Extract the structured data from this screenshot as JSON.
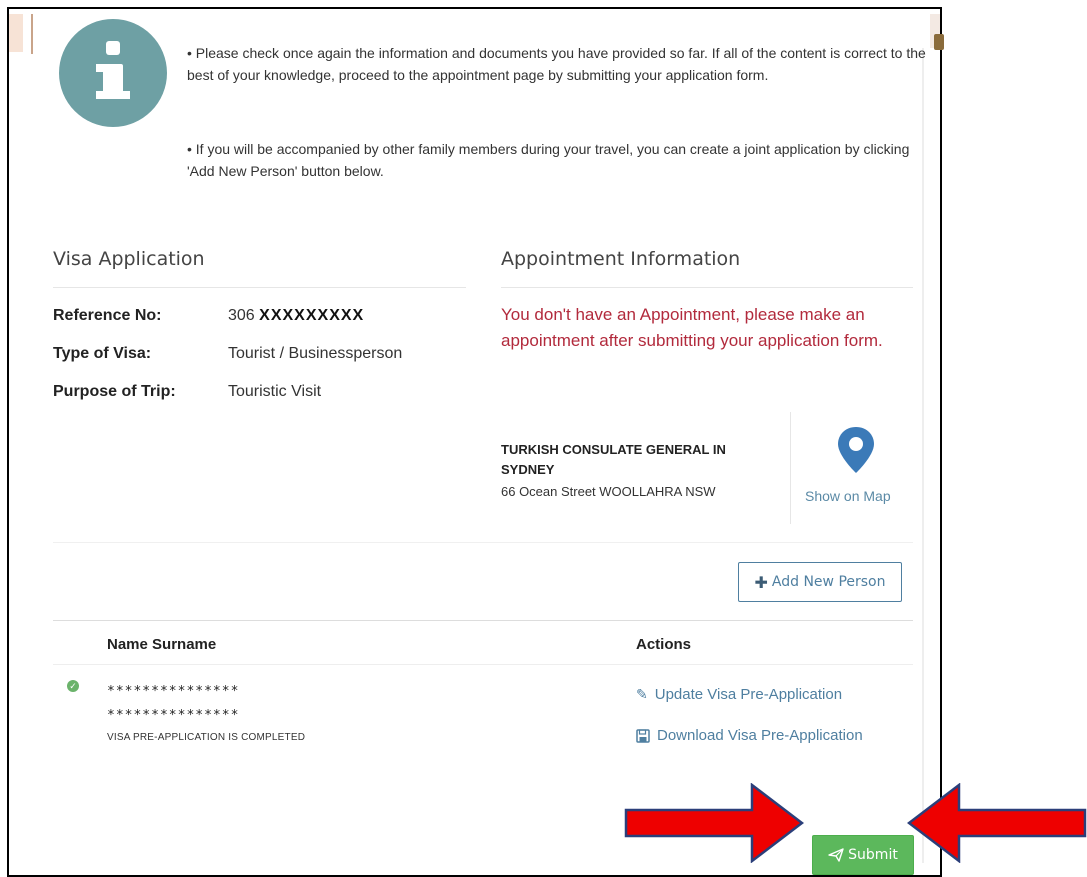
{
  "notice": {
    "line1": "• Please check once again the information and documents you have provided so far. If all of the content is correct to the best of your knowledge, proceed to the appointment page by submitting your application form.",
    "line2": "• If you will be accompanied by other family members during your travel, you can create a joint application by clicking 'Add New Person' button below."
  },
  "visa_application": {
    "title": "Visa Application",
    "fields": [
      {
        "label": "Reference No:",
        "value_prefix": "306",
        "value_masked": "XXXXXXXXX"
      },
      {
        "label": "Type of Visa:",
        "value": "Tourist / Businessperson"
      },
      {
        "label": "Purpose of Trip:",
        "value": "Touristic Visit"
      }
    ]
  },
  "appointment": {
    "title": "Appointment Information",
    "warning": "You don't have an Appointment, please make an appointment after submitting your application form.",
    "consulate_name": "TURKISH CONSULATE GENERAL IN SYDNEY",
    "consulate_address": "66 Ocean Street WOOLLAHRA NSW",
    "show_on_map": "Show on Map",
    "pin_icon": "map-pin-icon"
  },
  "toolbar": {
    "add_person_label": "Add New Person"
  },
  "table": {
    "headers": [
      "Name Surname",
      "Actions"
    ],
    "rows": [
      {
        "name_masked_line1": "***************",
        "name_masked_line2": "***************",
        "status": "VISA PRE-APPLICATION IS COMPLETED",
        "actions": [
          {
            "label": "Update Visa Pre-Application",
            "icon": "pencil-icon"
          },
          {
            "label": "Download Visa Pre-Application",
            "icon": "floppy-disk-icon"
          }
        ]
      }
    ]
  },
  "submit": {
    "label": "Submit",
    "icon": "paper-plane-icon"
  },
  "colors": {
    "info_circle": "#6ea0a4",
    "link": "#4f7fa0",
    "warning": "#b22a3c",
    "success": "#5cb85c",
    "annotation_arrow": "#ee0000"
  }
}
